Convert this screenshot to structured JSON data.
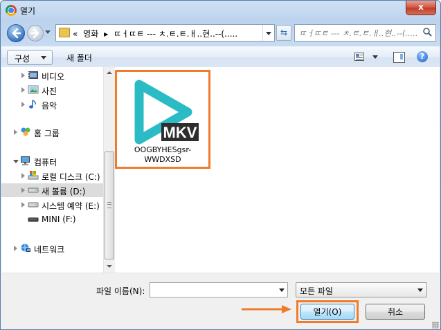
{
  "window": {
    "title": "열기",
    "close_label": "x"
  },
  "nav": {
    "breadcrumb": [
      "«",
      "영화",
      "ㄸㅓㄸㅌ --- ㅊ.ㅌ.ㅌ.ㅐ..현..--(....."
    ],
    "search_placeholder": "ㄸㅓㄸㅌ --- ㅊ.ㅌ.ㅌ.ㅐ..현..--(....."
  },
  "toolbar": {
    "organize_label": "구성",
    "new_folder_label": "새 폴더",
    "help_label": "?"
  },
  "tree": {
    "video": "비디오",
    "photos": "사진",
    "music": "음악",
    "homegroup": "홈 그룹",
    "computer": "컴퓨터",
    "local_disk": "로컬 디스크 (C:)",
    "new_volume": "새 볼륨 (D:)",
    "system_reserved": "시스템 예약 (E:)",
    "mini": "MINI (F:)",
    "network": "네트워크"
  },
  "file": {
    "badge": "MKV",
    "name_line1": "OOGBYHESgsr-",
    "name_line2": "WWDXSD"
  },
  "bottom": {
    "filename_label": "파일 이름(N):",
    "filename_value": "",
    "filter_label": "모든 파일",
    "open_label": "열기(O)",
    "cancel_label": "취소"
  },
  "colors": {
    "highlight": "#f07b2a",
    "mkv_play": "#2bbbc4"
  }
}
